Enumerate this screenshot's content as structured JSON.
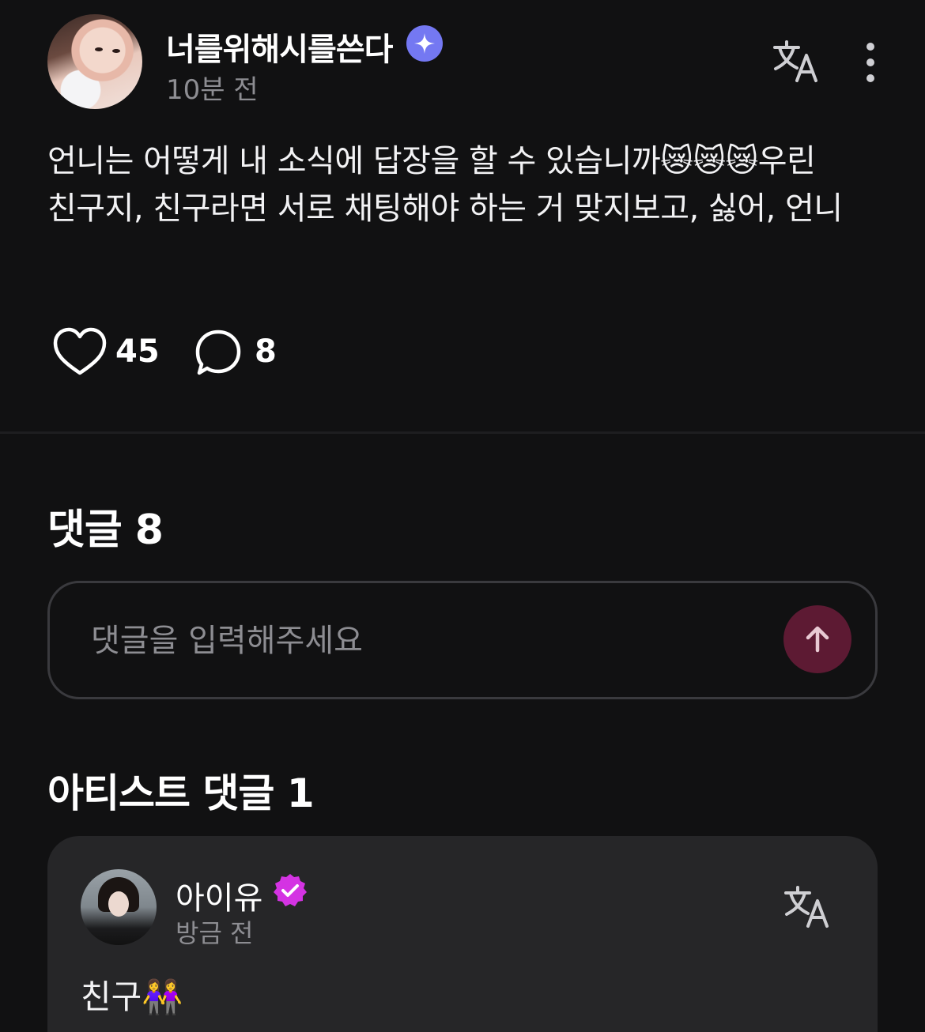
{
  "post": {
    "author": "너를위해시를쓴다",
    "time": "10분 전",
    "body": "언니는 어떻게 내 소식에 답장을 할 수 있습니까😿😿😿우린 친구지, 친구라면 서로 채팅해야 하는 거 맞지보고,  싫어, 언니",
    "like_count": "45",
    "comment_count": "8"
  },
  "comments": {
    "title": "댓글 8",
    "input_placeholder": "댓글을 입력해주세요"
  },
  "artist_comments": {
    "title": "아티스트 댓글 1",
    "items": [
      {
        "name": "아이유",
        "time": "방금 전",
        "text": "친구👭"
      }
    ]
  },
  "colors": {
    "background": "#111112",
    "card": "#262628",
    "ai_badge": "#7478f2",
    "verified_badge": "#d433e3",
    "send_button": "#5d1a33",
    "muted_text": "#8d8d92"
  },
  "icons": {
    "author_badge": "sparkle-badge-icon",
    "translate": "translate-icon",
    "more": "more-vertical-icon",
    "like": "heart-outline-icon",
    "comment": "speech-bubble-icon",
    "send": "arrow-up-icon",
    "artist_badge": "verified-check-icon"
  }
}
